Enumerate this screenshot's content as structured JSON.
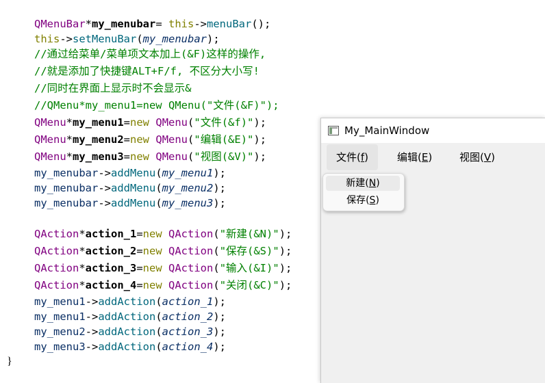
{
  "code_lines": [
    {
      "parts": [
        {
          "c": "cls",
          "t": "QMenuBar"
        },
        {
          "c": "plain",
          "t": "*"
        },
        {
          "c": "var",
          "t": "my_menubar"
        },
        {
          "c": "plain",
          "t": "= "
        },
        {
          "c": "kw",
          "t": "this"
        },
        {
          "c": "plain",
          "t": "->"
        },
        {
          "c": "fn",
          "t": "menuBar"
        },
        {
          "c": "plain",
          "t": "();"
        }
      ]
    },
    {
      "parts": [
        {
          "c": "kw",
          "t": "this"
        },
        {
          "c": "plain",
          "t": "->"
        },
        {
          "c": "fn",
          "t": "setMenuBar"
        },
        {
          "c": "plain",
          "t": "("
        },
        {
          "c": "param",
          "t": "my_menubar"
        },
        {
          "c": "plain",
          "t": ");"
        }
      ]
    },
    {
      "parts": [
        {
          "c": "cm",
          "t": "//通过给菜单/菜单项文本加上(&F)这样的操作,"
        }
      ]
    },
    {
      "parts": [
        {
          "c": "cm",
          "t": "//就是添加了快捷键ALT+F/f, 不区分大小写!"
        }
      ]
    },
    {
      "parts": [
        {
          "c": "cm",
          "t": "//同时在界面上显示时不会显示&"
        }
      ]
    },
    {
      "parts": [
        {
          "c": "cm",
          "t": "//QMenu*my_menu1=new QMenu(\"文件(&F)\");"
        }
      ]
    },
    {
      "parts": [
        {
          "c": "cls",
          "t": "QMenu"
        },
        {
          "c": "plain",
          "t": "*"
        },
        {
          "c": "var",
          "t": "my_menu1"
        },
        {
          "c": "plain",
          "t": "="
        },
        {
          "c": "kw",
          "t": "new"
        },
        {
          "c": "plain",
          "t": " "
        },
        {
          "c": "cls",
          "t": "QMenu"
        },
        {
          "c": "plain",
          "t": "("
        },
        {
          "c": "str",
          "t": "\"文件(&f)\""
        },
        {
          "c": "plain",
          "t": ");"
        }
      ]
    },
    {
      "parts": [
        {
          "c": "cls",
          "t": "QMenu"
        },
        {
          "c": "plain",
          "t": "*"
        },
        {
          "c": "var",
          "t": "my_menu2"
        },
        {
          "c": "plain",
          "t": "="
        },
        {
          "c": "kw",
          "t": "new"
        },
        {
          "c": "plain",
          "t": " "
        },
        {
          "c": "cls",
          "t": "QMenu"
        },
        {
          "c": "plain",
          "t": "("
        },
        {
          "c": "str",
          "t": "\"编辑(&E)\""
        },
        {
          "c": "plain",
          "t": ");"
        }
      ]
    },
    {
      "parts": [
        {
          "c": "cls",
          "t": "QMenu"
        },
        {
          "c": "plain",
          "t": "*"
        },
        {
          "c": "var",
          "t": "my_menu3"
        },
        {
          "c": "plain",
          "t": "="
        },
        {
          "c": "kw",
          "t": "new"
        },
        {
          "c": "plain",
          "t": " "
        },
        {
          "c": "cls",
          "t": "QMenu"
        },
        {
          "c": "plain",
          "t": "("
        },
        {
          "c": "str",
          "t": "\"视图(&V)\""
        },
        {
          "c": "plain",
          "t": ");"
        }
      ]
    },
    {
      "parts": [
        {
          "c": "param2",
          "t": "my_menubar"
        },
        {
          "c": "plain",
          "t": "->"
        },
        {
          "c": "fn",
          "t": "addMenu"
        },
        {
          "c": "plain",
          "t": "("
        },
        {
          "c": "param",
          "t": "my_menu1"
        },
        {
          "c": "plain",
          "t": ");"
        }
      ]
    },
    {
      "parts": [
        {
          "c": "param2",
          "t": "my_menubar"
        },
        {
          "c": "plain",
          "t": "->"
        },
        {
          "c": "fn",
          "t": "addMenu"
        },
        {
          "c": "plain",
          "t": "("
        },
        {
          "c": "param",
          "t": "my_menu2"
        },
        {
          "c": "plain",
          "t": ");"
        }
      ]
    },
    {
      "parts": [
        {
          "c": "param2",
          "t": "my_menubar"
        },
        {
          "c": "plain",
          "t": "->"
        },
        {
          "c": "fn",
          "t": "addMenu"
        },
        {
          "c": "plain",
          "t": "("
        },
        {
          "c": "param",
          "t": "my_menu3"
        },
        {
          "c": "plain",
          "t": ");"
        }
      ]
    },
    {
      "parts": [
        {
          "c": "cls",
          "t": "QAction"
        },
        {
          "c": "plain",
          "t": "*"
        },
        {
          "c": "var",
          "t": "action_1"
        },
        {
          "c": "plain",
          "t": "="
        },
        {
          "c": "kw",
          "t": "new"
        },
        {
          "c": "plain",
          "t": " "
        },
        {
          "c": "cls",
          "t": "QAction"
        },
        {
          "c": "plain",
          "t": "("
        },
        {
          "c": "str",
          "t": "\"新建(&N)\""
        },
        {
          "c": "plain",
          "t": ");"
        }
      ]
    },
    {
      "parts": [
        {
          "c": "cls",
          "t": "QAction"
        },
        {
          "c": "plain",
          "t": "*"
        },
        {
          "c": "var",
          "t": "action_2"
        },
        {
          "c": "plain",
          "t": "="
        },
        {
          "c": "kw",
          "t": "new"
        },
        {
          "c": "plain",
          "t": " "
        },
        {
          "c": "cls",
          "t": "QAction"
        },
        {
          "c": "plain",
          "t": "("
        },
        {
          "c": "str",
          "t": "\"保存(&S)\""
        },
        {
          "c": "plain",
          "t": ");"
        }
      ]
    },
    {
      "parts": [
        {
          "c": "cls",
          "t": "QAction"
        },
        {
          "c": "plain",
          "t": "*"
        },
        {
          "c": "var",
          "t": "action_3"
        },
        {
          "c": "plain",
          "t": "="
        },
        {
          "c": "kw",
          "t": "new"
        },
        {
          "c": "plain",
          "t": " "
        },
        {
          "c": "cls",
          "t": "QAction"
        },
        {
          "c": "plain",
          "t": "("
        },
        {
          "c": "str",
          "t": "\"输入(&I)\""
        },
        {
          "c": "plain",
          "t": ");"
        }
      ]
    },
    {
      "parts": [
        {
          "c": "cls",
          "t": "QAction"
        },
        {
          "c": "plain",
          "t": "*"
        },
        {
          "c": "var",
          "t": "action_4"
        },
        {
          "c": "plain",
          "t": "="
        },
        {
          "c": "kw",
          "t": "new"
        },
        {
          "c": "plain",
          "t": " "
        },
        {
          "c": "cls",
          "t": "QAction"
        },
        {
          "c": "plain",
          "t": "("
        },
        {
          "c": "str",
          "t": "\"关闭(&C)\""
        },
        {
          "c": "plain",
          "t": ");"
        }
      ]
    },
    {
      "parts": [
        {
          "c": "param2",
          "t": "my_menu1"
        },
        {
          "c": "plain",
          "t": "->"
        },
        {
          "c": "fn",
          "t": "addAction"
        },
        {
          "c": "plain",
          "t": "("
        },
        {
          "c": "param",
          "t": "action_1"
        },
        {
          "c": "plain",
          "t": ");"
        }
      ]
    },
    {
      "parts": [
        {
          "c": "param2",
          "t": "my_menu1"
        },
        {
          "c": "plain",
          "t": "->"
        },
        {
          "c": "fn",
          "t": "addAction"
        },
        {
          "c": "plain",
          "t": "("
        },
        {
          "c": "param",
          "t": "action_2"
        },
        {
          "c": "plain",
          "t": ");"
        }
      ]
    },
    {
      "parts": [
        {
          "c": "param2",
          "t": "my_menu2"
        },
        {
          "c": "plain",
          "t": "->"
        },
        {
          "c": "fn",
          "t": "addAction"
        },
        {
          "c": "plain",
          "t": "("
        },
        {
          "c": "param",
          "t": "action_3"
        },
        {
          "c": "plain",
          "t": ");"
        }
      ]
    },
    {
      "parts": [
        {
          "c": "param2",
          "t": "my_menu3"
        },
        {
          "c": "plain",
          "t": "->"
        },
        {
          "c": "fn",
          "t": "addAction"
        },
        {
          "c": "plain",
          "t": "("
        },
        {
          "c": "param",
          "t": "action_4"
        },
        {
          "c": "plain",
          "t": ");"
        }
      ]
    }
  ],
  "closing_brace": "}",
  "window": {
    "title": "My_MainWindow",
    "icon": "app-window-icon",
    "menus": [
      {
        "label": "文件(",
        "mnemonic": "f",
        "suffix": ")"
      },
      {
        "label": "编辑(",
        "mnemonic": "E",
        "suffix": ")"
      },
      {
        "label": "视图(",
        "mnemonic": "V",
        "suffix": ")"
      }
    ],
    "popup": [
      {
        "label": "新建(",
        "mnemonic": "N",
        "suffix": ")"
      },
      {
        "label": "保存(",
        "mnemonic": "S",
        "suffix": ")"
      }
    ]
  },
  "colors": {
    "class": "#800080",
    "keyword": "#808000",
    "string": "#008000",
    "comment": "#008000",
    "function": "#00677c",
    "parameter": "#092e64"
  }
}
